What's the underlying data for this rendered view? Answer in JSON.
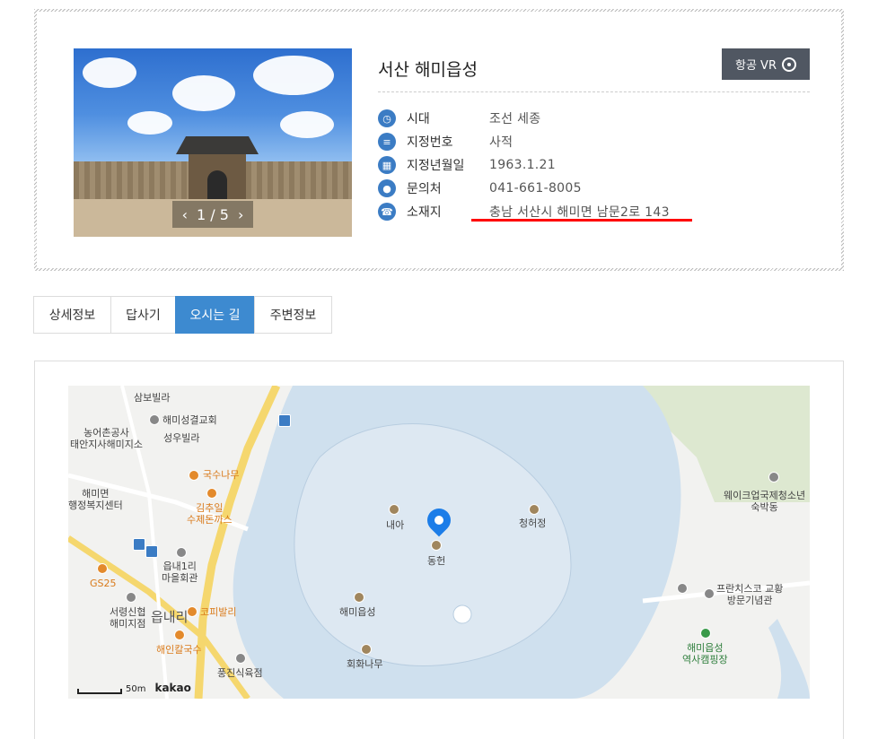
{
  "site": {
    "title": "서산 해미읍성",
    "vr_label": "항공 VR",
    "photo_counter": "1 / 5",
    "details": [
      {
        "icon": "clock-icon",
        "label": "시대",
        "value": "조선 세종"
      },
      {
        "icon": "document-icon",
        "label": "지정번호",
        "value": "사적"
      },
      {
        "icon": "calendar-icon",
        "label": "지정년월일",
        "value": "1963.1.21"
      },
      {
        "icon": "location-icon",
        "label": "문의처",
        "value": "041-661-8005"
      },
      {
        "icon": "phone-icon",
        "label": "소재지",
        "value": "충남 서산시 해미면 남문2로 143"
      }
    ],
    "accent_color": "#3d8ad0",
    "highlight_color": "#ff0000"
  },
  "tabs": [
    {
      "label": "상세정보",
      "active": false
    },
    {
      "label": "답사기",
      "active": false
    },
    {
      "label": "오시는 길",
      "active": true
    },
    {
      "label": "주변정보",
      "active": false
    }
  ],
  "map": {
    "labels": {
      "sambo": "삼보빌라",
      "church": "해미성결교회",
      "nongeo": "농어촌공사\n태안지사해미지소",
      "seongwoo": "성우빌라",
      "gugsu": "국수나무",
      "haemimyeon": "해미면\n행정복지센터",
      "kimchu": "김추일\n수제돈까스",
      "gs25": "GS25",
      "eupnae": "읍내1리\n마을회관",
      "seoryeong": "서령신협\n해미지점",
      "eupnaeri": "읍내리",
      "coffee": "코피발리",
      "haein": "해인칼국수",
      "pungjin": "풍진식육점",
      "naea": "내아",
      "donghyeon": "동헌",
      "cheongheo": "청허정",
      "haemieupseong": "해미읍성",
      "hoehwanamu": "회화나무",
      "wake": "웨이크업국제청소년\n숙박동",
      "francis": "프란치스코 교황\n방문기념관",
      "camping": "해미읍성\n역사캠핑장",
      "scale": "50m",
      "brand": "kakao"
    }
  }
}
